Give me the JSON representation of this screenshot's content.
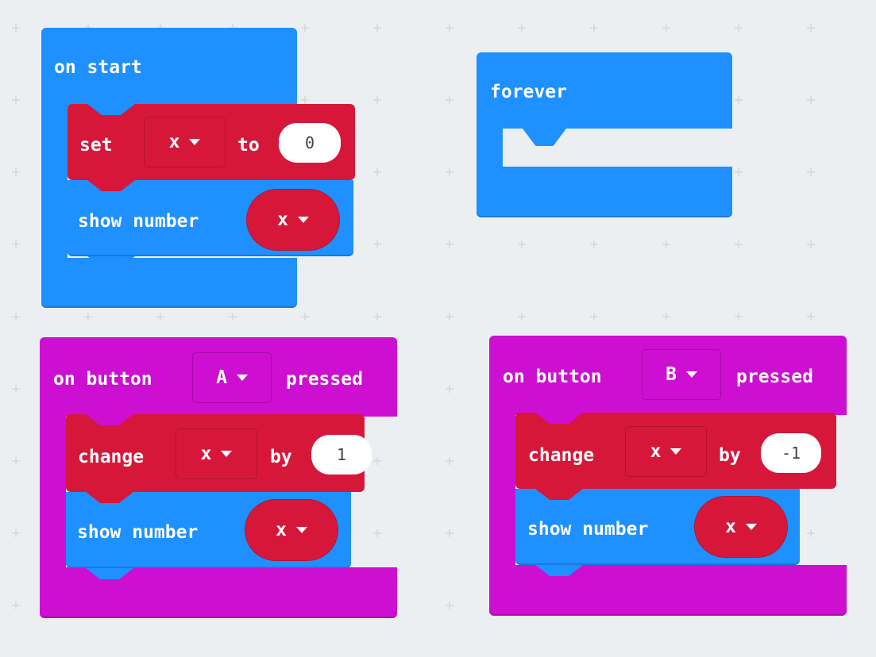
{
  "on_start": {
    "hat_label": "on start",
    "set_label": "set",
    "set_var": "x",
    "to_label": "to",
    "set_value": "0",
    "show_label": "show number",
    "show_var": "x"
  },
  "forever": {
    "hat_label": "forever"
  },
  "button_a": {
    "on_label": "on button",
    "button": "A",
    "pressed_label": "pressed",
    "change_label": "change",
    "change_var": "x",
    "by_label": "by",
    "change_value": "1",
    "show_label": "show number",
    "show_var": "x"
  },
  "button_b": {
    "on_label": "on button",
    "button": "B",
    "pressed_label": "pressed",
    "change_label": "change",
    "change_var": "x",
    "by_label": "by",
    "change_value": "-1",
    "show_label": "show number",
    "show_var": "x"
  },
  "colors": {
    "basic_blue": "#1e90ff",
    "input_magenta": "#cc0fd1",
    "variable_red": "#d7173a",
    "workspace_bg": "#eceff1"
  }
}
